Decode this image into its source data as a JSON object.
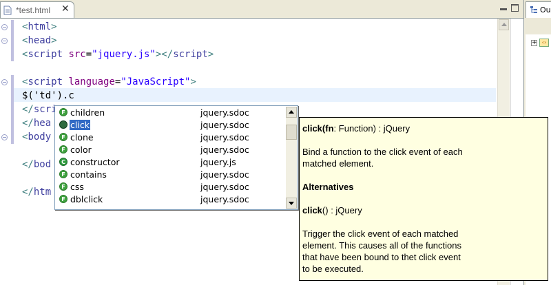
{
  "tab": {
    "title": "*test.html",
    "close": "✕"
  },
  "outline": {
    "label": "Ou",
    "node_expand": "+",
    "node_icon": "‹›"
  },
  "code_lines": [
    [
      {
        "c": "tag",
        "t": "<"
      },
      {
        "c": "tagtext",
        "t": "html"
      },
      {
        "c": "tag",
        "t": ">"
      }
    ],
    [
      {
        "c": "tag",
        "t": "<"
      },
      {
        "c": "tagtext",
        "t": "head"
      },
      {
        "c": "tag",
        "t": ">"
      }
    ],
    [
      {
        "c": "tag",
        "t": "<"
      },
      {
        "c": "tagtext",
        "t": "script"
      },
      {
        "c": "plain",
        "t": " "
      },
      {
        "c": "attr",
        "t": "src"
      },
      {
        "c": "plain",
        "t": "="
      },
      {
        "c": "str",
        "t": "\"jquery.js\""
      },
      {
        "c": "tag",
        "t": "></"
      },
      {
        "c": "tagtext",
        "t": "script"
      },
      {
        "c": "tag",
        "t": ">"
      }
    ],
    [],
    [
      {
        "c": "tag",
        "t": "<"
      },
      {
        "c": "tagtext",
        "t": "script"
      },
      {
        "c": "plain",
        "t": " "
      },
      {
        "c": "attr",
        "t": "language"
      },
      {
        "c": "plain",
        "t": "="
      },
      {
        "c": "str",
        "t": "\"JavaScript\""
      },
      {
        "c": "tag",
        "t": ">"
      }
    ],
    [
      {
        "c": "plain",
        "t": "$('td').c"
      }
    ],
    [
      {
        "c": "tag",
        "t": "</"
      },
      {
        "c": "tagtext",
        "t": "scri"
      }
    ],
    [
      {
        "c": "tag",
        "t": "</"
      },
      {
        "c": "tagtext",
        "t": "hea"
      }
    ],
    [
      {
        "c": "tag",
        "t": "<"
      },
      {
        "c": "tagtext",
        "t": "body"
      }
    ],
    [],
    [
      {
        "c": "tag",
        "t": "</"
      },
      {
        "c": "tagtext",
        "t": "bod"
      }
    ],
    [],
    [
      {
        "c": "tag",
        "t": "</"
      },
      {
        "c": "tagtext",
        "t": "htm"
      }
    ]
  ],
  "assist": {
    "items": [
      {
        "name": "children",
        "source": "jquery.sdoc",
        "kind": "function",
        "icon_letter": "F"
      },
      {
        "name": "click",
        "source": "jquery.sdoc",
        "kind": "function-selected",
        "icon_letter": "",
        "selected": true
      },
      {
        "name": "clone",
        "source": "jquery.sdoc",
        "kind": "function",
        "icon_letter": "F"
      },
      {
        "name": "color",
        "source": "jquery.sdoc",
        "kind": "function",
        "icon_letter": "F"
      },
      {
        "name": "constructor",
        "source": "jquery.js",
        "kind": "constructor",
        "icon_letter": "C"
      },
      {
        "name": "contains",
        "source": "jquery.sdoc",
        "kind": "function",
        "icon_letter": "F"
      },
      {
        "name": "css",
        "source": "jquery.sdoc",
        "kind": "function",
        "icon_letter": "F"
      },
      {
        "name": "dblclick",
        "source": "jquery.sdoc",
        "kind": "function",
        "icon_letter": "F"
      }
    ]
  },
  "doc": {
    "signature_name": "click",
    "signature_params_open": "(",
    "signature_param_name": "fn",
    "signature_param_type": ": Function) : jQuery",
    "desc_line1": "Bind a function to the click event of each",
    "desc_line2": "matched element.",
    "alternatives_heading": "Alternatives",
    "alt_name": "click",
    "alt_rest": "() : jQuery",
    "alt_desc_line1": "Trigger the click event of each matched",
    "alt_desc_line2": "element. This causes all of the functions",
    "alt_desc_line3": "that have been bound to thet click event",
    "alt_desc_line4": "to be executed."
  }
}
